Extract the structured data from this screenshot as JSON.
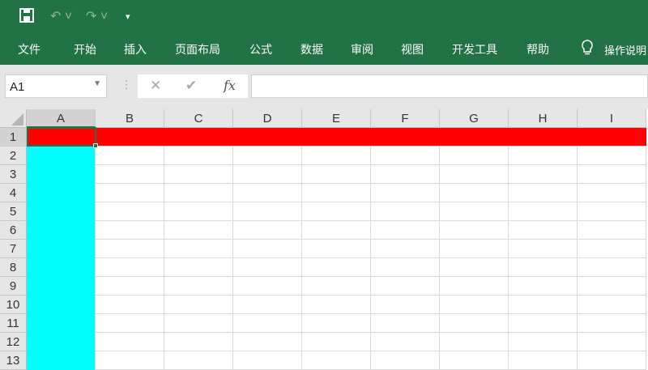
{
  "quick_access": {
    "save": "save-icon",
    "undo": "undo-icon",
    "redo": "redo-icon",
    "customize": "▾"
  },
  "tabs": [
    "文件",
    "开始",
    "插入",
    "页面布局",
    "公式",
    "数据",
    "审阅",
    "视图",
    "开发工具",
    "帮助"
  ],
  "tell_me": "操作说明",
  "name_box": "A1",
  "fx_label": "fx",
  "formula_value": "",
  "columns": [
    "A",
    "B",
    "C",
    "D",
    "E",
    "F",
    "G",
    "H",
    "I"
  ],
  "rows": [
    "1",
    "2",
    "3",
    "4",
    "5",
    "6",
    "7",
    "8",
    "9",
    "10",
    "11",
    "12",
    "13"
  ],
  "fill_colors": {
    "row1": "#ff0000",
    "columnA": "#00ffff"
  },
  "selected_cell": "A1"
}
